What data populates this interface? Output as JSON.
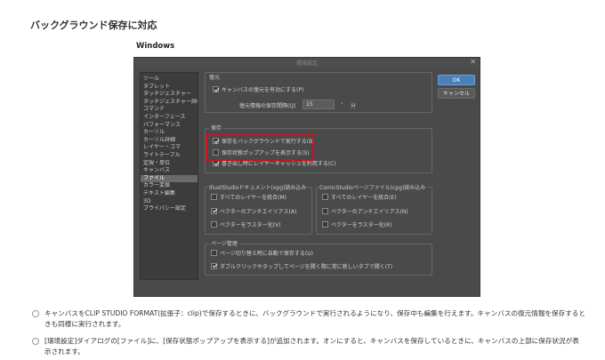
{
  "heading": "バックグラウンド保存に対応",
  "os_label": "Windows",
  "dialog": {
    "title": "環境設定",
    "close_glyph": "✕",
    "sidebar_items": [
      "ツール",
      "タブレット",
      "タッチジェスチャー",
      "タッチジェスチャー詳細",
      "コマンド",
      "インターフェース",
      "パフォーマンス",
      "カーソル",
      "カーソル詳細",
      "レイヤー・コマ",
      "ライトテーブル",
      "定規・単位",
      "キャンバス",
      "ファイル",
      "カラー変換",
      "テキスト編集",
      "3D",
      "プライバシー設定"
    ],
    "selected_index": 13,
    "ok_label": "OK",
    "cancel_label": "キャンセル",
    "restore": {
      "title": "復元",
      "enable_label": "キャンバスの復元を有効にする(P)",
      "interval_label": "復元情報の保存間隔(Q)",
      "interval_value": "15",
      "spin_glyph": "›",
      "unit": "分"
    },
    "save": {
      "title": "保存",
      "items": [
        {
          "label": "保存をバックグラウンドで実行する(B)",
          "checked": true
        },
        {
          "label": "保存状態ポップアップを表示する(S)",
          "checked": false
        },
        {
          "label": "書き出し時にレイヤーキャッシュを利用する(C)",
          "checked": true
        }
      ]
    },
    "illust": {
      "title": "IllustStudioドキュメント(xpg)読み込み",
      "items": [
        {
          "label": "すべてのレイヤーを統合(M)",
          "checked": false
        },
        {
          "label": "ベクターのアンチエイリアス(A)",
          "checked": true
        },
        {
          "label": "ベクターをラスター化(V)",
          "checked": false
        }
      ]
    },
    "comic": {
      "title": "ComicStudioページファイル(cpg)読み込み",
      "items": [
        {
          "label": "すべてのレイヤーを統合(E)",
          "checked": false
        },
        {
          "label": "ベクターのアンチエイリアス(N)",
          "checked": false
        },
        {
          "label": "ベクターをラスター化(R)",
          "checked": false
        }
      ]
    },
    "page": {
      "title": "ページ管理",
      "items": [
        {
          "label": "ページ切り替え時に自動で保存する(U)",
          "checked": false
        },
        {
          "label": "ダブルクリックやタップしてページを開く際に常に新しいタブで開く(T)",
          "checked": true
        }
      ]
    }
  },
  "notes": [
    "キャンバスをCLIP STUDIO FORMAT(拡張子：clip)で保存するときに、バックグラウンドで実行されるようになり、保存中も編集を行えます。キャンバスの復元情報を保存するときも同様に実行されます。",
    "[環境設定]ダイアログの[ファイル]に、[保存状態ポップアップを表示する]が追加されます。オンにすると、キャンバスを保存しているときに、キャンバスの上部に保存状況が表示されます。"
  ]
}
